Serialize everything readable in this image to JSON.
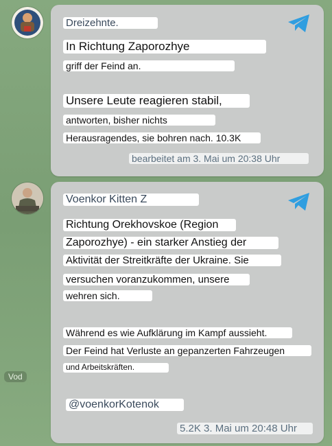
{
  "messages": [
    {
      "author": "Dreizehnte.",
      "lines": [
        "In Richtung Zaporozhye",
        "griff der Feind an.",
        "Unsere Leute reagieren stabil,",
        "antworten, bisher nichts",
        "Herausragendes, sie bohren nach. 10.3K"
      ],
      "meta": "bearbeitet am 3. Mai um 20:38 Uhr"
    },
    {
      "author": "Voenkor Kitten Z",
      "lines": [
        "Richtung Orekhovskoe (Region",
        "Zaporozhye) - ein starker Anstieg der",
        "Aktivität der Streitkräfte der Ukraine. Sie",
        "versuchen voranzukommen, unsere",
        "wehren sich.",
        "Während es wie Aufklärung im Kampf aussieht.",
        "Der Feind hat Verluste an gepanzerten Fahrzeugen",
        "und Arbeitskräften."
      ],
      "handle": "@voenkorKotenok",
      "meta": "5.2K 3. Mai um 20:48 Uhr"
    }
  ],
  "side_label": "Vod",
  "icons": {
    "channel": "telegram-plane-icon"
  },
  "colors": {
    "bubble": "#c9cbca",
    "telegram_blue": "#2f9ee0",
    "wallpaper": "#7fa27a"
  }
}
